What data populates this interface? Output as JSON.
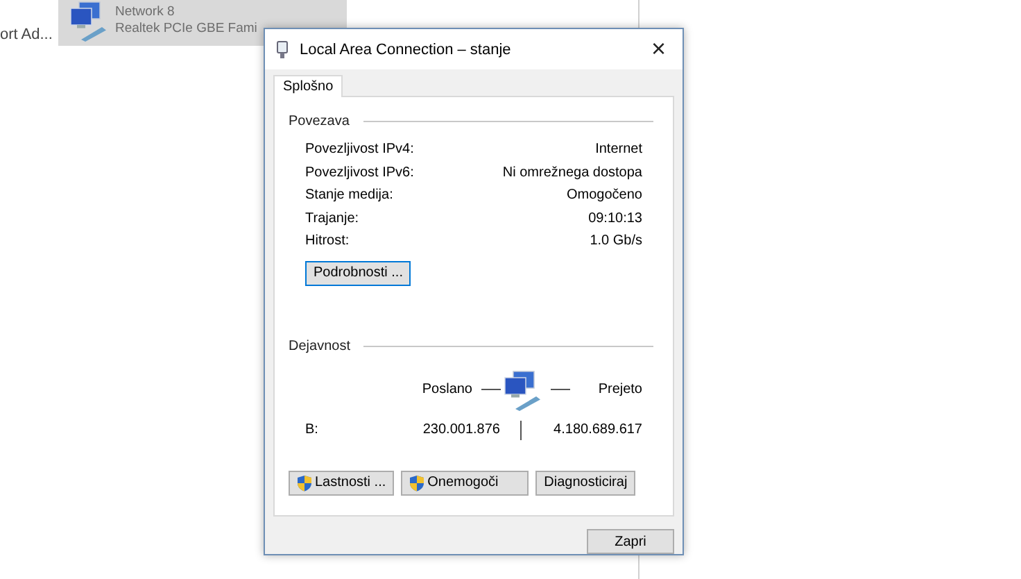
{
  "background": {
    "left_text": "ort Ad...",
    "item": {
      "subtitle": "Network  8",
      "device": "Realtek PCIe GBE Fami",
      "selected": true
    }
  },
  "dialog": {
    "title": "Local Area Connection – stanje",
    "close": "×",
    "tabs": [
      {
        "label": "Splošno",
        "selected": true
      }
    ],
    "connection": {
      "heading": "Povezava",
      "rows": [
        {
          "label": "Povezljivost IPv4:",
          "value": "Internet"
        },
        {
          "label": "Povezljivost IPv6:",
          "value": "Ni omrežnega dostopa"
        },
        {
          "label": "Stanje medija:",
          "value": "Omogočeno"
        },
        {
          "label": "Trajanje:",
          "value": "09:10:13"
        },
        {
          "label": "Hitrost:",
          "value": "1.0 Gb/s"
        }
      ],
      "details_button": "Podrobnosti ..."
    },
    "activity": {
      "heading": "Dejavnost",
      "sent_label": "Poslano",
      "received_label": "Prejeto",
      "bytes_label": "B:",
      "sent": "230.001.876",
      "received": "4.180.689.617"
    },
    "buttons": [
      {
        "label": "Lastnosti ...",
        "shield": true
      },
      {
        "label": "Onemogoči",
        "shield": true
      },
      {
        "label": "Diagnosticiraj",
        "shield": false
      }
    ],
    "close_button": "Zapri"
  }
}
